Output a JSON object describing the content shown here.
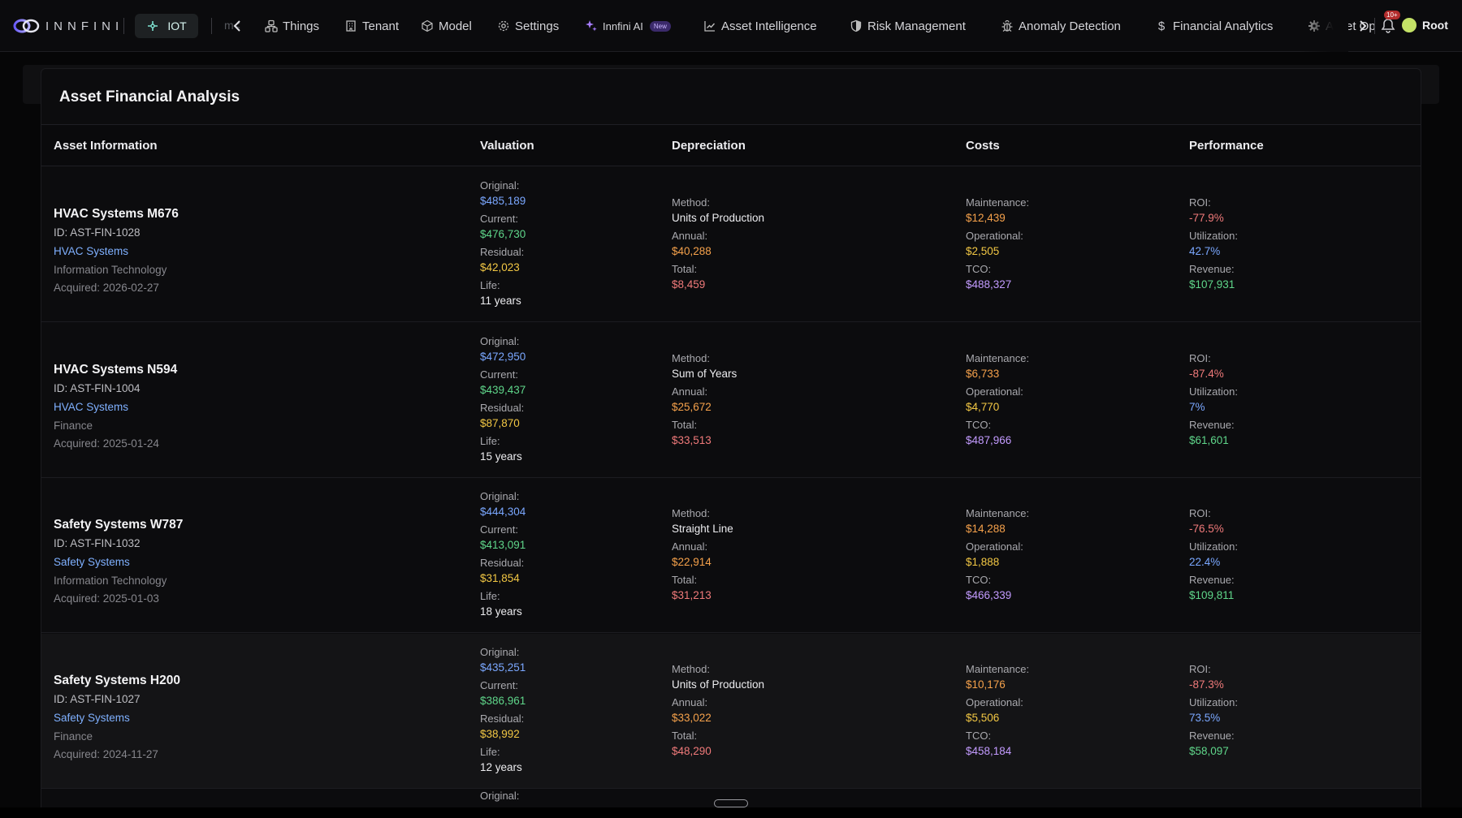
{
  "header": {
    "logo_text": "INNFINI",
    "iot_label": "IOT",
    "faded_text": "m<",
    "nav": [
      {
        "label": "Things",
        "icon": "things-icon"
      },
      {
        "label": "Tenant",
        "icon": "building-icon"
      },
      {
        "label": "Model",
        "icon": "cube-icon"
      },
      {
        "label": "Settings",
        "icon": "gear-icon"
      },
      {
        "label": "Innfini AI",
        "icon": "sparkle-icon",
        "badge": "New"
      },
      {
        "label": "Asset Intelligence",
        "icon": "chart-line-icon"
      },
      {
        "label": "Risk Management",
        "icon": "shield-icon"
      },
      {
        "label": "Anomaly Detection",
        "icon": "bug-icon"
      },
      {
        "label": "Financial Analytics",
        "icon": "dollar-icon"
      },
      {
        "label": "Asset Op",
        "icon": "cog-icon"
      }
    ],
    "notification_count": "10+",
    "user": "Root"
  },
  "page": {
    "title": "Asset Financial Analysis",
    "columns": [
      "Asset Information",
      "Valuation",
      "Depreciation",
      "Costs",
      "Performance"
    ],
    "labels": {
      "original": "Original:",
      "current": "Current:",
      "residual": "Residual:",
      "life": "Life:",
      "method": "Method:",
      "annual": "Annual:",
      "total": "Total:",
      "maintenance": "Maintenance:",
      "operational": "Operational:",
      "tco": "TCO:",
      "roi": "ROI:",
      "utilization": "Utilization:",
      "revenue": "Revenue:"
    },
    "rows": [
      {
        "name": "HVAC Systems M676",
        "id": "ID: AST-FIN-1028",
        "category": "HVAC Systems",
        "department": "Information Technology",
        "acquired": "Acquired: 2026-02-27",
        "original": "$485,189",
        "current": "$476,730",
        "residual": "$42,023",
        "life": "11 years",
        "method": "Units of Production",
        "annual": "$40,288",
        "total": "$8,459",
        "maintenance": "$12,439",
        "operational": "$2,505",
        "tco": "$488,327",
        "roi": "-77.9%",
        "utilization": "42.7%",
        "revenue": "$107,931"
      },
      {
        "name": "HVAC Systems N594",
        "id": "ID: AST-FIN-1004",
        "category": "HVAC Systems",
        "department": "Finance",
        "acquired": "Acquired: 2025-01-24",
        "original": "$472,950",
        "current": "$439,437",
        "residual": "$87,870",
        "life": "15 years",
        "method": "Sum of Years",
        "annual": "$25,672",
        "total": "$33,513",
        "maintenance": "$6,733",
        "operational": "$4,770",
        "tco": "$487,966",
        "roi": "-87.4%",
        "utilization": "7%",
        "revenue": "$61,601"
      },
      {
        "name": "Safety Systems W787",
        "id": "ID: AST-FIN-1032",
        "category": "Safety Systems",
        "department": "Information Technology",
        "acquired": "Acquired: 2025-01-03",
        "original": "$444,304",
        "current": "$413,091",
        "residual": "$31,854",
        "life": "18 years",
        "method": "Straight Line",
        "annual": "$22,914",
        "total": "$31,213",
        "maintenance": "$14,288",
        "operational": "$1,888",
        "tco": "$466,339",
        "roi": "-76.5%",
        "utilization": "22.4%",
        "revenue": "$109,811"
      },
      {
        "name": "Safety Systems H200",
        "id": "ID: AST-FIN-1027",
        "category": "Safety Systems",
        "department": "Finance",
        "acquired": "Acquired: 2024-11-27",
        "original": "$435,251",
        "current": "$386,961",
        "residual": "$38,992",
        "life": "12 years",
        "method": "Units of Production",
        "annual": "$33,022",
        "total": "$48,290",
        "maintenance": "$10,176",
        "operational": "$5,506",
        "tco": "$458,184",
        "roi": "-87.3%",
        "utilization": "73.5%",
        "revenue": "$58,097"
      }
    ],
    "partial_row_label": "Original:"
  }
}
